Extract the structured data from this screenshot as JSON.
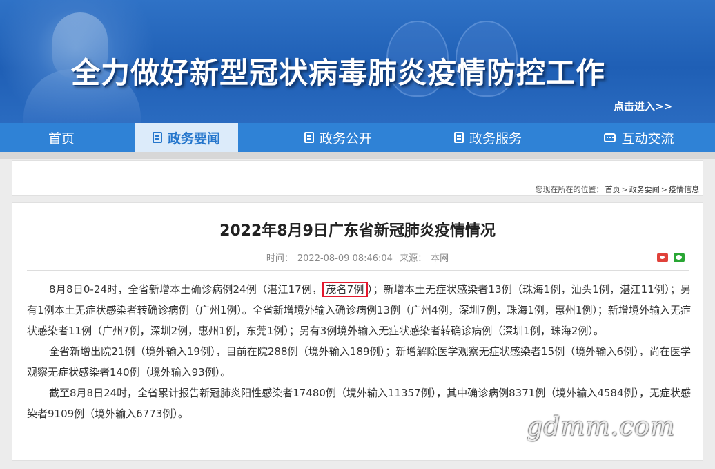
{
  "banner": {
    "title": "全力做好新型冠状病毒肺炎疫情防控工作",
    "enter_link": "点击进入>>"
  },
  "nav": {
    "items": [
      {
        "label": "首页",
        "active": false
      },
      {
        "label": "政务要闻",
        "active": true,
        "icon": "newspaper-icon"
      },
      {
        "label": "政务公开",
        "active": false,
        "icon": "document-icon"
      },
      {
        "label": "政务服务",
        "active": false,
        "icon": "clipboard-icon"
      },
      {
        "label": "互动交流",
        "active": false,
        "icon": "chat-icon"
      }
    ]
  },
  "breadcrumb": {
    "prefix": "您现在所在的位置：",
    "items": [
      "首页",
      "政务要闻",
      "疫情信息"
    ],
    "separator": ">"
  },
  "article": {
    "title": "2022年8月9日广东省新冠肺炎疫情情况",
    "time_label": "时间：",
    "time_value": "2022-08-09 08:46:04",
    "source_label": "来源：",
    "source_value": "本网",
    "share_icons": [
      "weibo-icon",
      "wechat-icon"
    ],
    "p1_before": "8月8日0-24时，全省新增本土确诊病例24例（湛江17例，",
    "p1_highlight": "茂名7例",
    "p1_after": "）；新增本土无症状感染者13例（珠海1例，汕头1例，湛江11例）；另有1例本土无症状感染者转确诊病例（广州1例）。全省新增境外输入确诊病例13例（广州4例，深圳7例，珠海1例，惠州1例）；新增境外输入无症状感染者11例（广州7例，深圳2例，惠州1例，东莞1例）；另有3例境外输入无症状感染者转确诊病例（深圳1例，珠海2例）。",
    "p2": "全省新增出院21例（境外输入19例），目前在院288例（境外输入189例）；新增解除医学观察无症状感染者15例（境外输入6例），尚在医学观察无症状感染者140例（境外输入93例）。",
    "p3": "截至8月8日24时，全省累计报告新冠肺炎阳性感染者17480例（境外输入11357例），其中确诊病例8371例（境外输入4584例），无症状感染者9109例（境外输入6773例）。"
  },
  "watermark": "gdmm.com",
  "colors": {
    "nav_bg": "#2f82d6",
    "nav_active_bg": "#dcebfa",
    "highlight_border": "#e3182d"
  }
}
